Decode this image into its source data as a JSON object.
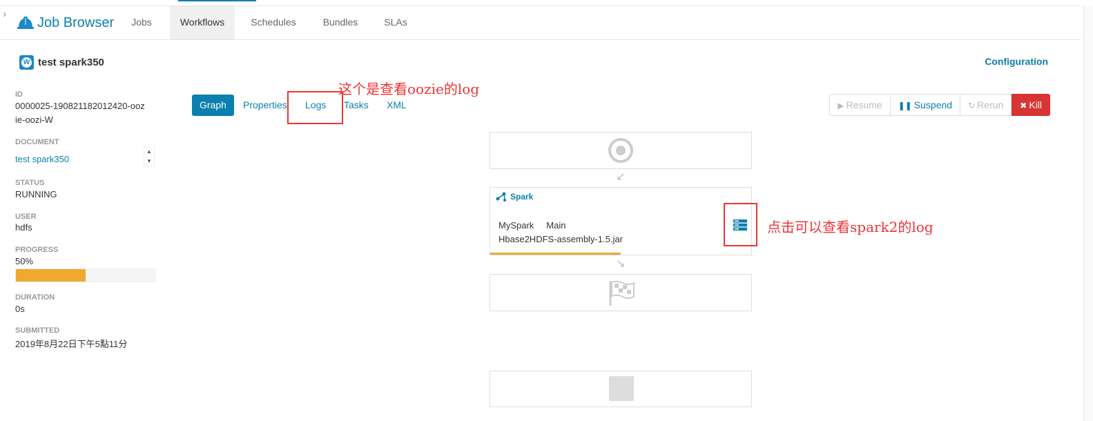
{
  "navbar": {
    "brand": "Job Browser",
    "items": [
      {
        "label": "Jobs",
        "active": false
      },
      {
        "label": "Workflows",
        "active": true
      },
      {
        "label": "Schedules",
        "active": false
      },
      {
        "label": "Bundles",
        "active": false
      },
      {
        "label": "SLAs",
        "active": false
      }
    ]
  },
  "workflow": {
    "badge": "W",
    "name": "test spark350",
    "configuration_link": "Configuration"
  },
  "sidebar": {
    "id_label": "ID",
    "id_line1": "0000025-190821182012420-ooz",
    "id_line2": "ie-oozi-W",
    "document_label": "DOCUMENT",
    "document_value": "test spark350",
    "status_label": "STATUS",
    "status_value": "RUNNING",
    "user_label": "USER",
    "user_value": "hdfs",
    "progress_label": "PROGRESS",
    "progress_value": "50%",
    "progress_fraction": 0.5,
    "duration_label": "DURATION",
    "duration_value": "0s",
    "submitted_label": "SUBMITTED",
    "submitted_value": "2019年8月22日下午5點11分"
  },
  "tabs": [
    {
      "label": "Graph",
      "active": true
    },
    {
      "label": "Properties",
      "active": false
    },
    {
      "label": "Logs",
      "active": false
    },
    {
      "label": "Tasks",
      "active": false
    },
    {
      "label": "XML",
      "active": false
    }
  ],
  "actions": {
    "resume": "Resume",
    "suspend": "Suspend",
    "rerun": "Rerun",
    "kill": "Kill"
  },
  "graph": {
    "spark_node": {
      "type_label": "Spark",
      "name": "MySpark",
      "class": "Main",
      "jar": "Hbase2HDFS-assembly-1.5.jar",
      "progress_fraction": 0.5
    }
  },
  "annotations": {
    "logs_note": "这个是查看oozie的log",
    "spark_note": "点击可以查看spark2的log"
  },
  "colors": {
    "accent": "#0b7fad",
    "progress": "#f0a92e",
    "danger": "#d93434",
    "annotation": "#e33333"
  }
}
